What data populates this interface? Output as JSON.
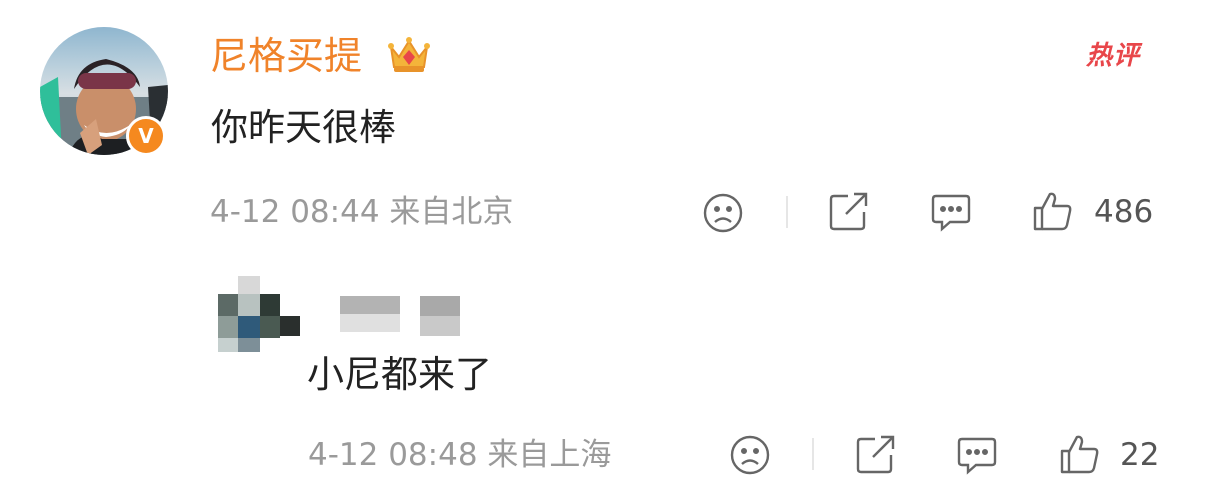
{
  "comment": {
    "username": "尼格买提",
    "badge_label": "热评",
    "text": "你昨天很棒",
    "meta": "4-12 08:44  来自北京",
    "like_count": "486"
  },
  "reply": {
    "text": "小尼都来了",
    "meta": "4-12 08:48  来自上海",
    "like_count": "22"
  },
  "colors": {
    "username": "#f0832a",
    "hot_badge": "#e8464a",
    "verified": "#f5891f"
  },
  "icons": {
    "dislike": "sad-face-icon",
    "share": "share-icon",
    "comment": "comment-bubble-icon",
    "like": "thumbs-up-icon",
    "vip": "crown-icon",
    "verified": "verified-v-icon"
  }
}
